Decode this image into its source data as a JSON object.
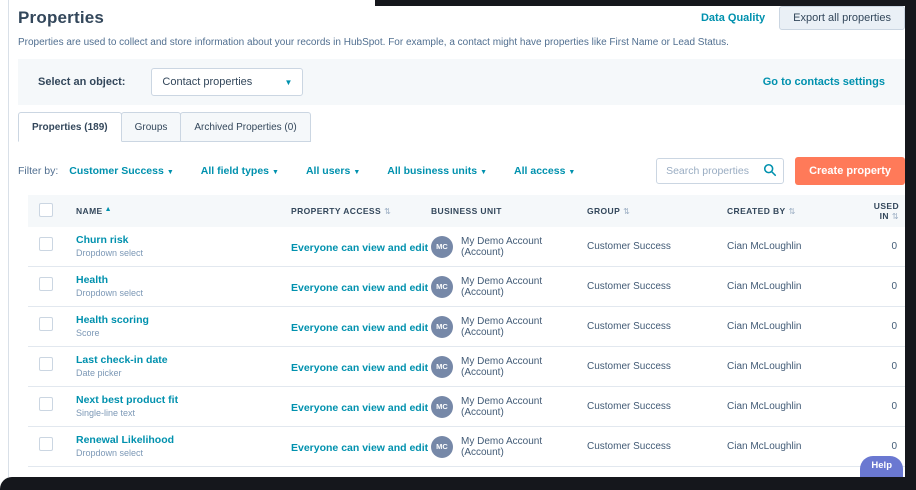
{
  "header": {
    "title": "Properties",
    "description": "Properties are used to collect and store information about your records in HubSpot. For example, a contact might have properties like First Name or Lead Status.",
    "data_quality_label": "Data Quality",
    "export_button_label": "Export all properties"
  },
  "object_selector": {
    "label": "Select an object:",
    "selected": "Contact properties",
    "settings_link_label": "Go to contacts settings"
  },
  "tabs": {
    "properties": "Properties (189)",
    "groups": "Groups",
    "archived": "Archived Properties (0)"
  },
  "filter_bar": {
    "label": "Filter by:",
    "group_filter": "Customer Success",
    "field_types_filter": "All field types",
    "users_filter": "All users",
    "business_units_filter": "All business units",
    "access_filter": "All access",
    "search_placeholder": "Search properties",
    "create_button_label": "Create property"
  },
  "table": {
    "headers": {
      "name": "NAME",
      "property_access": "PROPERTY ACCESS",
      "business_unit": "BUSINESS UNIT",
      "group": "GROUP",
      "created_by": "CREATED BY",
      "used_in": "USED IN"
    },
    "rows": [
      {
        "name": "Churn risk",
        "type": "Dropdown select",
        "access": "Everyone can view and edit",
        "avatar_initials": "MC",
        "business_unit": "My Demo Account (Account)",
        "group": "Customer Success",
        "created_by": "Cian McLoughlin",
        "used_in": "0"
      },
      {
        "name": "Health",
        "type": "Dropdown select",
        "access": "Everyone can view and edit",
        "avatar_initials": "MC",
        "business_unit": "My Demo Account (Account)",
        "group": "Customer Success",
        "created_by": "Cian McLoughlin",
        "used_in": "0"
      },
      {
        "name": "Health scoring",
        "type": "Score",
        "access": "Everyone can view and edit",
        "avatar_initials": "MC",
        "business_unit": "My Demo Account (Account)",
        "group": "Customer Success",
        "created_by": "Cian McLoughlin",
        "used_in": "0"
      },
      {
        "name": "Last check-in date",
        "type": "Date picker",
        "access": "Everyone can view and edit",
        "avatar_initials": "MC",
        "business_unit": "My Demo Account (Account)",
        "group": "Customer Success",
        "created_by": "Cian McLoughlin",
        "used_in": "0"
      },
      {
        "name": "Next best product fit",
        "type": "Single-line text",
        "access": "Everyone can view and edit",
        "avatar_initials": "MC",
        "business_unit": "My Demo Account (Account)",
        "group": "Customer Success",
        "created_by": "Cian McLoughlin",
        "used_in": "0"
      },
      {
        "name": "Renewal Likelihood",
        "type": "Dropdown select",
        "access": "Everyone can view and edit",
        "avatar_initials": "MC",
        "business_unit": "My Demo Account (Account)",
        "group": "Customer Success",
        "created_by": "Cian McLoughlin",
        "used_in": "0"
      }
    ]
  },
  "help_button_label": "Help",
  "colors": {
    "accent_teal": "#0091ae",
    "primary_orange": "#ff7a59",
    "dark_text": "#33475b",
    "avatar_bg": "#7688a8",
    "help_bg": "#6a78d1"
  }
}
